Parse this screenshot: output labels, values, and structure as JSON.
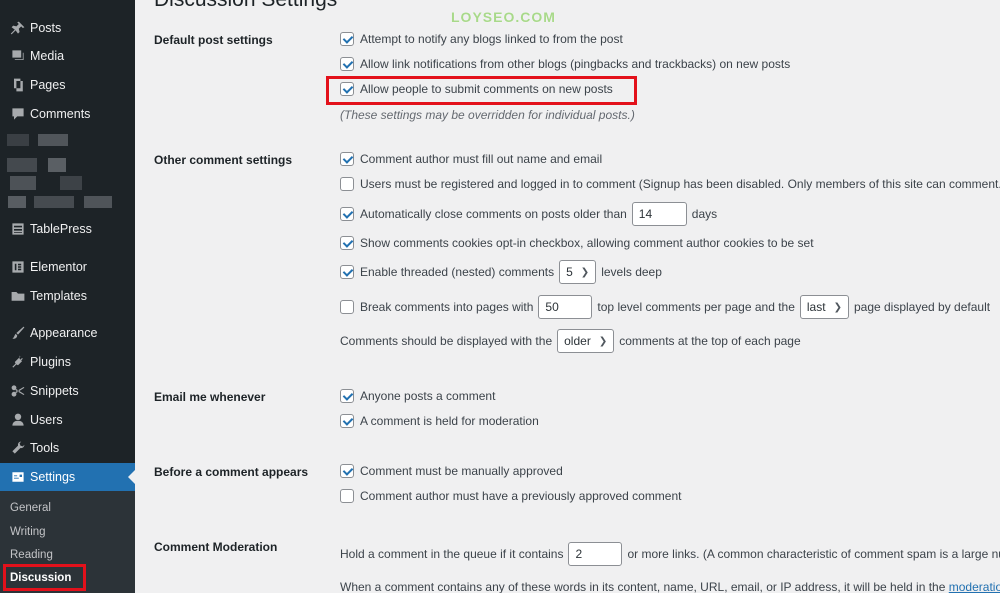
{
  "page": {
    "title": "Discussion Settings",
    "watermark": "LOYSEO.COM"
  },
  "sidebar": {
    "items": [
      {
        "label": "Posts",
        "icon": "pin-icon"
      },
      {
        "label": "Media",
        "icon": "media-icon"
      },
      {
        "label": "Pages",
        "icon": "pages-icon"
      },
      {
        "label": "Comments",
        "icon": "comment-icon"
      },
      {
        "label": "TablePress",
        "icon": "table-icon"
      },
      {
        "label": "Elementor",
        "icon": "elementor-icon"
      },
      {
        "label": "Templates",
        "icon": "folder-icon"
      },
      {
        "label": "Appearance",
        "icon": "brush-icon"
      },
      {
        "label": "Plugins",
        "icon": "plug-icon"
      },
      {
        "label": "Snippets",
        "icon": "scissors-icon"
      },
      {
        "label": "Users",
        "icon": "user-icon"
      },
      {
        "label": "Tools",
        "icon": "wrench-icon"
      },
      {
        "label": "Settings",
        "icon": "settings-icon"
      }
    ],
    "submenu": [
      "General",
      "Writing",
      "Reading",
      "Discussion"
    ]
  },
  "default_post": {
    "label": "Default post settings",
    "options": [
      {
        "text": "Attempt to notify any blogs linked to from the post",
        "checked": true
      },
      {
        "text": "Allow link notifications from other blogs (pingbacks and trackbacks) on new posts",
        "checked": true
      },
      {
        "text": "Allow people to submit comments on new posts",
        "checked": true
      }
    ],
    "hint": "(These settings may be overridden for individual posts.)"
  },
  "other_comment": {
    "label": "Other comment settings",
    "name_email": "Comment author must fill out name and email",
    "registered": "Users must be registered and logged in to comment (Signup has been disabled. Only members of this site can comment.)",
    "auto_close_prefix": "Automatically close comments on posts older than",
    "auto_close_value": "14",
    "auto_close_suffix": "days",
    "cookies": "Show comments cookies opt-in checkbox, allowing comment author cookies to be set",
    "threaded_prefix": "Enable threaded (nested) comments",
    "threaded_value": "5",
    "threaded_suffix": "levels deep",
    "pages_prefix": "Break comments into pages with",
    "pages_value": "50",
    "pages_middle": "top level comments per page and the",
    "pages_select": "last",
    "pages_suffix": "page displayed by default",
    "order_prefix": "Comments should be displayed with the",
    "order_select": "older",
    "order_suffix": "comments at the top of each page"
  },
  "email": {
    "label": "Email me whenever",
    "options": [
      {
        "text": "Anyone posts a comment",
        "checked": true
      },
      {
        "text": "A comment is held for moderation",
        "checked": true
      }
    ]
  },
  "before_appears": {
    "label": "Before a comment appears",
    "options": [
      {
        "text": "Comment must be manually approved",
        "checked": true
      },
      {
        "text": "Comment author must have a previously approved comment",
        "checked": false
      }
    ]
  },
  "moderation": {
    "label": "Comment Moderation",
    "queue_prefix": "Hold a comment in the queue if it contains",
    "queue_value": "2",
    "queue_suffix": "or more links. (A common characteristic of comment spam is a large nu",
    "words_text": "When a comment contains any of these words in its content, name, URL, email, or IP address, it will be held in the",
    "words_link": "moderation q"
  },
  "colors": {
    "sidebar_bg": "#1d2327",
    "accent": "#2271b1",
    "highlight_red": "#e3111b"
  }
}
